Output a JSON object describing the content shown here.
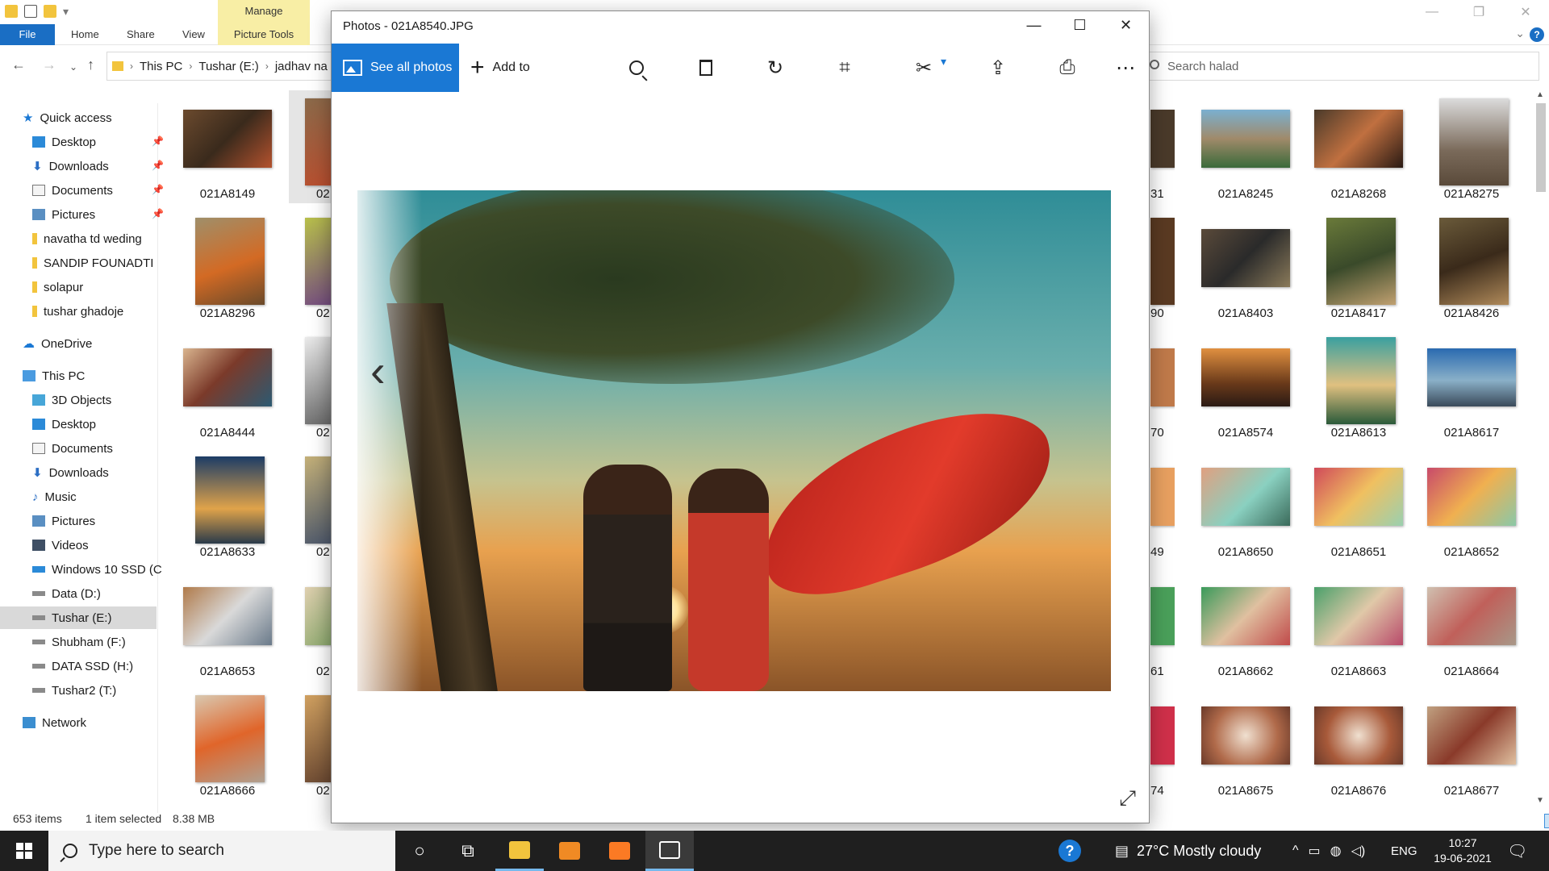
{
  "explorer": {
    "ribbon_context": "Manage",
    "tabs": [
      "File",
      "Home",
      "Share",
      "View",
      "Picture Tools"
    ],
    "breadcrumb": [
      "This PC",
      "Tushar (E:)",
      "jadhav na"
    ],
    "search_placeholder": "Search halad",
    "nav": {
      "quick_access": "Quick access",
      "quick_items": [
        "Desktop",
        "Downloads",
        "Documents",
        "Pictures",
        "navatha td weding",
        "SANDIP FOUNADTI",
        "solapur",
        "tushar ghadoje"
      ],
      "onedrive": "OneDrive",
      "this_pc": "This PC",
      "pc_items": [
        "3D Objects",
        "Desktop",
        "Documents",
        "Downloads",
        "Music",
        "Pictures",
        "Videos",
        "Windows 10 SSD (C",
        "Data (D:)",
        "Tushar (E:)",
        "Shubham (F:)",
        "DATA SSD (H:)",
        "Tushar2 (T:)"
      ],
      "network": "Network"
    },
    "files_left": [
      [
        "021A8149",
        "02"
      ],
      [
        "021A8296",
        "02"
      ],
      [
        "021A8444",
        "02"
      ],
      [
        "021A8633",
        "02"
      ],
      [
        "021A8653",
        "02"
      ],
      [
        "021A8666",
        "02"
      ]
    ],
    "files_partial": [
      "31",
      "90",
      "70",
      "49",
      "61",
      "74"
    ],
    "files_right": [
      [
        "021A8245",
        "021A8268",
        "021A8275"
      ],
      [
        "021A8403",
        "021A8417",
        "021A8426"
      ],
      [
        "021A8574",
        "021A8613",
        "021A8617"
      ],
      [
        "021A8650",
        "021A8651",
        "021A8652"
      ],
      [
        "021A8662",
        "021A8663",
        "021A8664"
      ],
      [
        "021A8675",
        "021A8676",
        "021A8677"
      ]
    ],
    "status": {
      "items": "653 items",
      "selected": "1 item selected",
      "size": "8.38 MB"
    }
  },
  "photos": {
    "title": "Photos - 021A8540.JPG",
    "see_all": "See all photos",
    "add_to": "Add to"
  },
  "taskbar": {
    "search_placeholder": "Type here to search",
    "weather": "27°C  Mostly cloudy",
    "language": "ENG",
    "time": "10:27",
    "date": "19-06-2021"
  },
  "colors": {
    "accent": "#1a78d4",
    "explorer_file_tab": "#1a6ec4",
    "manage_tab": "#f8eea5",
    "taskbar": "#1f1f1f"
  }
}
